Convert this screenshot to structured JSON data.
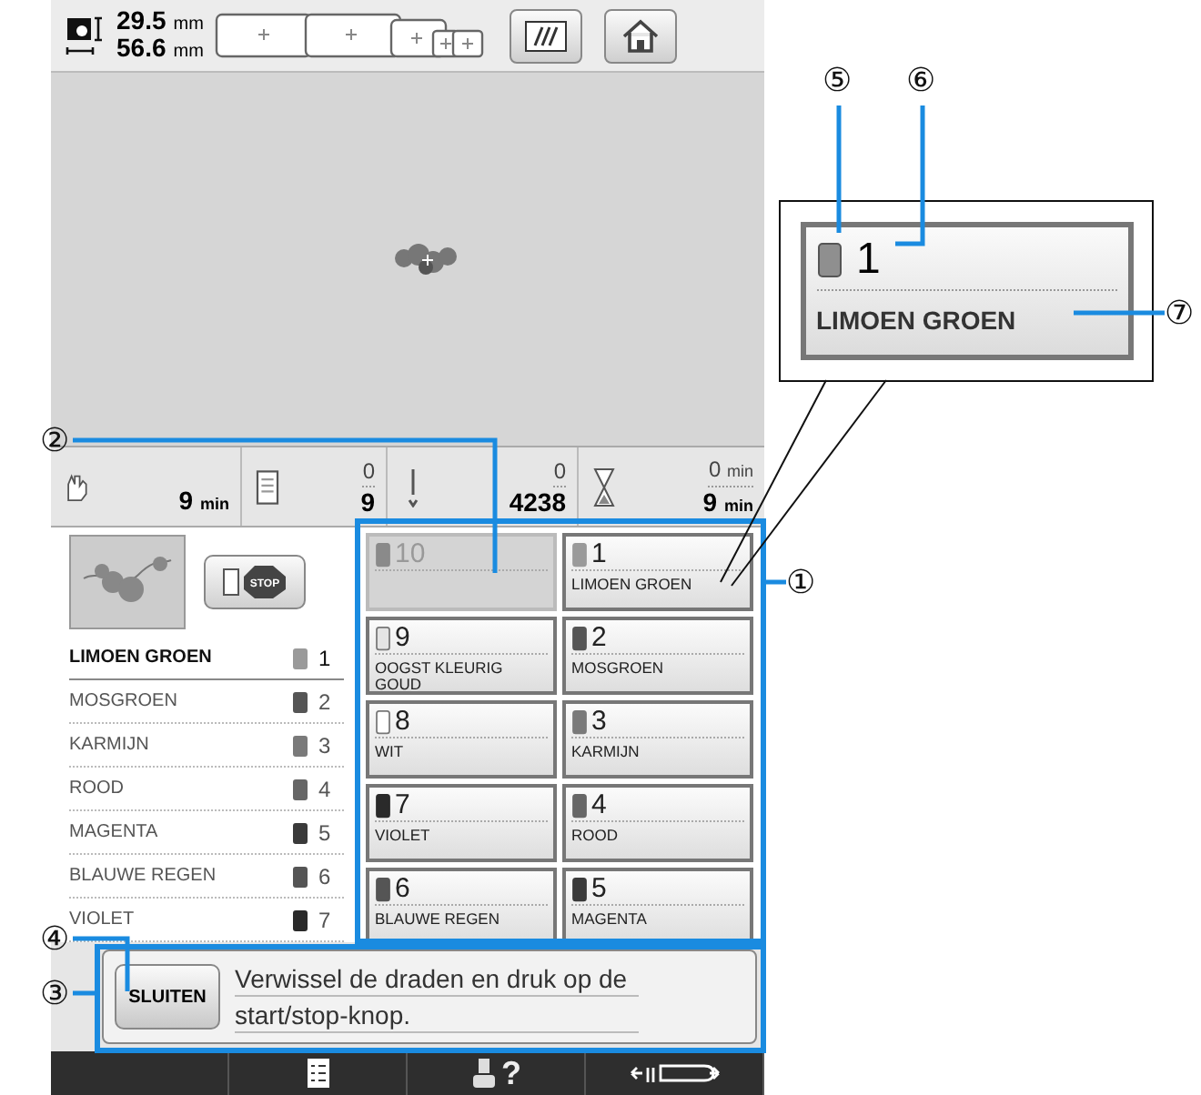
{
  "top_bar": {
    "size": [
      {
        "value": "29.5",
        "unit": "mm"
      },
      {
        "value": "56.6",
        "unit": "mm"
      }
    ]
  },
  "status": {
    "time_left": {
      "value": "9",
      "unit": "min"
    },
    "colors": {
      "current": "0",
      "total": "9"
    },
    "stitches": {
      "current": "0",
      "total": "4238"
    },
    "time": {
      "current": "0",
      "current_unit": "min",
      "total": "9",
      "total_unit": "min"
    }
  },
  "stop_button": {
    "label": "STOP"
  },
  "thread_list": [
    {
      "name": "LIMOEN GROEN",
      "number": "1",
      "color": "#9a9a9a",
      "selected": true
    },
    {
      "name": "MOSGROEN",
      "number": "2",
      "color": "#555555",
      "selected": false
    },
    {
      "name": "KARMIJN",
      "number": "3",
      "color": "#7a7a7a",
      "selected": false
    },
    {
      "name": "ROOD",
      "number": "4",
      "color": "#666666",
      "selected": false
    },
    {
      "name": "MAGENTA",
      "number": "5",
      "color": "#3a3a3a",
      "selected": false
    },
    {
      "name": "BLAUWE REGEN",
      "number": "6",
      "color": "#555555",
      "selected": false
    },
    {
      "name": "VIOLET",
      "number": "7",
      "color": "#2a2a2a",
      "selected": false
    }
  ],
  "thread_grid": [
    {
      "number": "10",
      "color": "#8a8a8a",
      "disabled": true
    },
    {
      "number": "1",
      "name": "LIMOEN GROEN",
      "color": "#9a9a9a",
      "disabled": false
    },
    {
      "number": "9",
      "name": "OOGST KLEURIG GOUD",
      "color": "#e4e4e4",
      "disabled": false
    },
    {
      "number": "2",
      "name": "MOSGROEN",
      "color": "#555555",
      "disabled": false
    },
    {
      "number": "8",
      "name": "WIT",
      "color": "#ffffff",
      "disabled": false
    },
    {
      "number": "3",
      "name": "KARMIJN",
      "color": "#7a7a7a",
      "disabled": false
    },
    {
      "number": "7",
      "name": "VIOLET",
      "color": "#2a2a2a",
      "disabled": false
    },
    {
      "number": "4",
      "name": "ROOD",
      "color": "#666666",
      "disabled": false
    },
    {
      "number": "6",
      "name": "BLAUWE REGEN",
      "color": "#555555",
      "disabled": false
    },
    {
      "number": "5",
      "name": "MAGENTA",
      "color": "#3a3a3a",
      "disabled": false
    }
  ],
  "message": {
    "button": "SLUITEN",
    "text": "Verwissel de draden en druk op de start/stop-knop."
  },
  "bottom_bar": [
    {
      "kind": "checklist"
    },
    {
      "kind": "help",
      "label": "?"
    },
    {
      "kind": "hoop_move"
    }
  ],
  "zoom_box": {
    "number": "1",
    "name": "LIMOEN GROEN",
    "color": "#8f8f8f"
  },
  "callouts": [
    {
      "label": "⑤"
    },
    {
      "label": "⑥"
    },
    {
      "label": "⑦"
    },
    {
      "label": "②"
    },
    {
      "label": "①"
    },
    {
      "label": "④"
    },
    {
      "label": "③"
    }
  ]
}
